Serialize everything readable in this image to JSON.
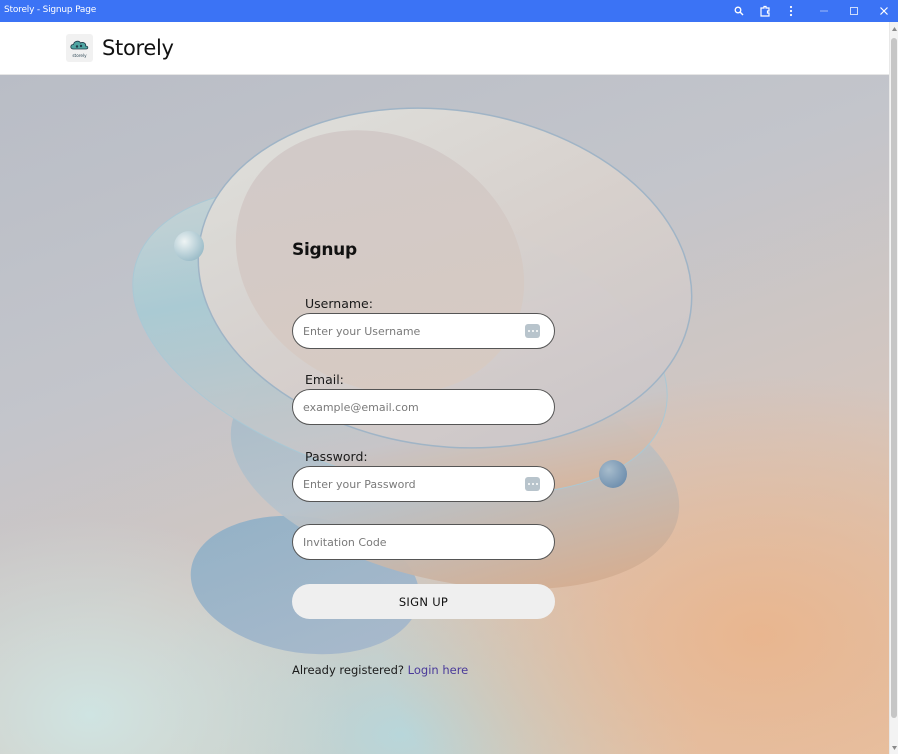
{
  "window": {
    "title": "Storely - Signup Page"
  },
  "header": {
    "brand": "Storely",
    "logo_icon": "cloud-logo-icon",
    "logo_text": "storely"
  },
  "form": {
    "title": "Signup",
    "username": {
      "label": "Username:",
      "placeholder": "Enter your Username"
    },
    "email": {
      "label": "Email:",
      "placeholder": "example@email.com"
    },
    "password": {
      "label": "Password:",
      "placeholder": "Enter your Password"
    },
    "invitation": {
      "placeholder": "Invitation Code"
    },
    "submit_label": "SIGN UP",
    "login_prompt": "Already registered?",
    "login_link": "Login here"
  },
  "colors": {
    "titlebar": "#3b73f5",
    "link": "#4a3a9a"
  }
}
